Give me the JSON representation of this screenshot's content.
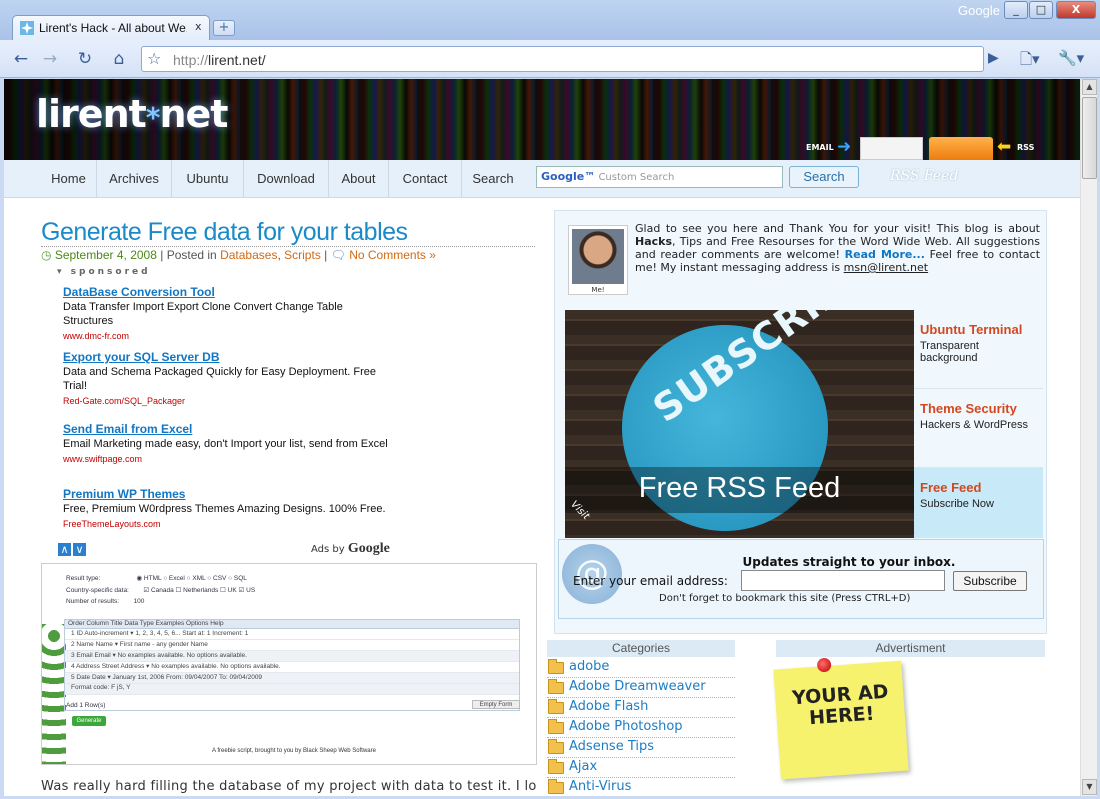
{
  "browser": {
    "tab_title": "Lirent's Hack - All about We...",
    "tab_close": "x",
    "new_tab": "+",
    "brand": "Google",
    "url_proto": "http://",
    "url_host": "lirent.net/",
    "window_min": "_",
    "window_max": "□",
    "window_close": "X"
  },
  "header": {
    "logo_main": "lirent",
    "logo_star": "*",
    "logo_tail": "net",
    "email_label": "EMAIL",
    "rss_label": "RSS"
  },
  "nav": {
    "items": [
      "Home",
      "Archives",
      "Ubuntu",
      "Download",
      "About",
      "Contact",
      "Search"
    ],
    "search_placeholder_brand": "Google™",
    "search_placeholder": "Custom Search",
    "search_button": "Search",
    "rss_feed_deco": "RSS Feed"
  },
  "post": {
    "title": "Generate Free data for your tables",
    "date": "September 4, 2008",
    "posted_in": "| Posted in",
    "category_1": "Databases",
    "category_2": "Scripts",
    "comments": "No Comments »",
    "sponsored": "sponsored",
    "ads": [
      {
        "title": "DataBase Conversion Tool",
        "desc": "Data Transfer Import Export Clone Convert Change Table Structures",
        "url": "www.dmc-fr.com"
      },
      {
        "title": "Export your SQL Server DB",
        "desc": "Data and Schema Packaged Quickly for Easy Deployment. Free Trial!",
        "url": "Red-Gate.com/SQL_Packager"
      },
      {
        "title": "Send Email from Excel",
        "desc": "Email Marketing made easy, don't Import your list, send from Excel",
        "url": "www.swiftpage.com"
      },
      {
        "title": "Premium WP Themes",
        "desc": "Free, Premium W0rdpress Themes Amazing Designs. 100% Free.",
        "url": "FreeThemeLayouts.com"
      }
    ],
    "ads_by": "Ads by",
    "ads_by_brand": "Google",
    "image": {
      "result_type_label": "Result type:",
      "result_type_options": "◉ HTML  ○ Excel  ○ XML  ○ CSV  ○ SQL",
      "country_label": "Country-specific data:",
      "country_options": "☑ Canada  ☐ Netherlands  ☐ UK  ☑ US",
      "results_label": "Number of results:",
      "results_value": "100",
      "table_header": "Order   Column Title          Data Type                   Examples                    Options                                    Help",
      "rows": [
        "1   ID            Auto-increment ▾      1, 2, 3, 4, 5, 6...            Start at: 1      Increment: 1",
        "2   Name          Name ▾                First name - any gender        Name",
        "3   Email         Email ▾               No examples available.         No options available.",
        "4   Address       Street Address ▾      No examples available.         No options available.",
        "5   Date          Date ▾                January 1st, 2006              From: 09/04/2007  To: 09/04/2009",
        "                                                                       Format code: F jS, Y"
      ],
      "add_label": "Add  1   Row(s)",
      "generate": "Generate",
      "empty_form": "Empty Form",
      "credit": "A freebie script, brought to you by Black Sheep Web Software"
    },
    "body_text": "Was really hard filling the database of my project with data to test it. I lose"
  },
  "sidebar": {
    "avatar_caption": "Me!",
    "welcome_1": "Glad to see you here and Thank You for your visit! This blog is about ",
    "welcome_hacks": "Hacks",
    "welcome_2": ", Tips and Free Resourses for the Word Wide Web. All suggestions and reader comments are welcome! ",
    "welcome_more": "Read More...",
    "welcome_3": " Feel free to contact me! My instant messaging address is ",
    "welcome_msn": "msn@lirent.net",
    "subscribe_text": "SUBSCRIBE TODAY!",
    "free_rss": "Free RSS Feed",
    "visit": "Visit",
    "features": [
      {
        "title": "Ubuntu Terminal",
        "sub": "Transparent background"
      },
      {
        "title": "Theme Security",
        "sub": "Hackers & WordPress"
      },
      {
        "title": "Free Feed",
        "sub": "Subscribe Now"
      }
    ],
    "updates": "Updates straight to your inbox.",
    "enter_email": "Enter your email address:",
    "subscribe_button": "Subscribe",
    "bookmark": "Don't forget to bookmark this site (Press CTRL+D)",
    "categories_head": "Categories",
    "advert_head": "Advertisment",
    "categories": [
      "adobe",
      "Adobe Dreamweaver",
      "Adobe Flash",
      "Adobe Photoshop",
      "Adsense Tips",
      "Ajax",
      "Anti-Virus"
    ],
    "your_ad": "YOUR AD HERE!"
  },
  "colors": {
    "title_blue": "#1a8ac8",
    "link_blue": "#1177c4",
    "orange": "#d26a14",
    "feature_red": "#d3481e"
  }
}
